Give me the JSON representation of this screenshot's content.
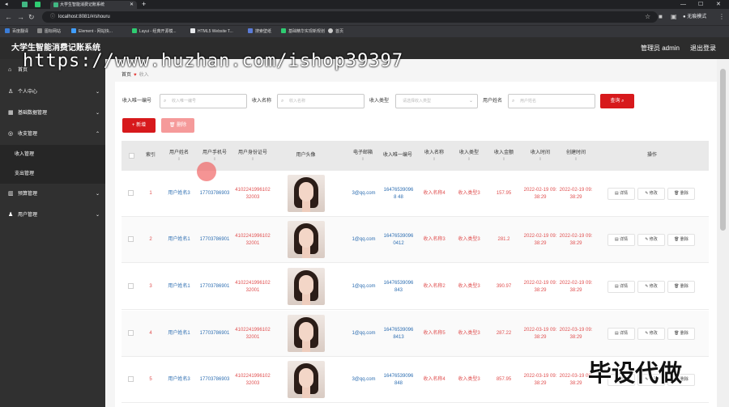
{
  "browser": {
    "tab_title": "大学生智能消费记账系统",
    "url": "localhost:8081/#/shouru",
    "profile_label": "无痕模式",
    "bookmarks": [
      "百度翻译",
      "图标网站",
      "Element - 网站快...",
      "Layui - 经典开源模...",
      "HTML5 Website T...",
      "搜索壁纸",
      "基础精华实现新规划",
      "首页"
    ]
  },
  "header": {
    "title": "大学生智能消费记账系统",
    "admin_label": "管理员 admin",
    "logout_label": "退出登录"
  },
  "sidebar": {
    "items": [
      {
        "label": "首页",
        "icon": "home-icon"
      },
      {
        "label": "个人中心",
        "icon": "user-icon"
      },
      {
        "label": "基础数据管理",
        "icon": "grid-icon"
      },
      {
        "label": "收支管理",
        "icon": "money-icon"
      },
      {
        "label": "收入管理",
        "sub": true
      },
      {
        "label": "支出管理",
        "sub": true
      },
      {
        "label": "预算管理",
        "icon": "chart-icon"
      },
      {
        "label": "用户管理",
        "icon": "users-icon"
      }
    ]
  },
  "breadcrumb": {
    "home": "首页",
    "current": "收入"
  },
  "filters": {
    "code_label": "收入唯一编号",
    "code_placeholder": "收入唯一编号",
    "name_label": "收入名称",
    "name_placeholder": "收入名称",
    "type_label": "收入类型",
    "type_placeholder": "请选择收入类型",
    "user_label": "用户姓名",
    "user_placeholder": "用户姓名",
    "search_button": "查询"
  },
  "actions": {
    "add_button": "+ 新增",
    "delete_button": "删除"
  },
  "table": {
    "headers": [
      "索引",
      "用户姓名",
      "用户手机号",
      "用户身份证号",
      "用户头像",
      "电子邮箱",
      "收入唯一编号",
      "收入名称",
      "收入类型",
      "收入金额",
      "收入时间",
      "创建时间",
      "操作"
    ],
    "op_labels": [
      "详情",
      "修改",
      "删除"
    ],
    "rows": [
      {
        "index": "1",
        "name": "用户姓名3",
        "phone": "17703786903",
        "idcard": "410224199610232003",
        "email": "3@qq.com",
        "code": "164765390968 48",
        "income_name": "收入名称4",
        "income_type": "收入类型3",
        "amount": "157.95",
        "income_time": "2022-02-19 09:38:29",
        "created": "2022-02-19 09:38:29"
      },
      {
        "index": "2",
        "name": "用户姓名1",
        "phone": "17703786901",
        "idcard": "410224199610232001",
        "email": "1@qq.com",
        "code": "164765390960412",
        "income_name": "收入名称3",
        "income_type": "收入类型3",
        "amount": "281.2",
        "income_time": "2022-02-19 09:38:29",
        "created": "2022-02-19 09:38:29"
      },
      {
        "index": "3",
        "name": "用户姓名1",
        "phone": "17703786901",
        "idcard": "410224199610232001",
        "email": "1@qq.com",
        "code": "16476539096843",
        "income_name": "收入名称2",
        "income_type": "收入类型3",
        "amount": "390.97",
        "income_time": "2022-02-19 09:38:29",
        "created": "2022-02-19 09:38:29"
      },
      {
        "index": "4",
        "name": "用户姓名1",
        "phone": "17703786901",
        "idcard": "410224199610232001",
        "email": "1@qq.com",
        "code": "164765390968413",
        "income_name": "收入名称5",
        "income_type": "收入类型3",
        "amount": "287.22",
        "income_time": "2022-03-19 09:38:29",
        "created": "2022-03-19 09:38:29"
      },
      {
        "index": "5",
        "name": "用户姓名3",
        "phone": "17703786903",
        "idcard": "410224199610232003",
        "email": "3@qq.com",
        "code": "16476539096848",
        "income_name": "收入名称4",
        "income_type": "收入类型3",
        "amount": "857.95",
        "income_time": "2022-03-19 09:38:29",
        "created": "2022-03-19 09:38:29"
      }
    ]
  },
  "overlay": {
    "watermark_url": "https://www.huzhan.com/ishop39397",
    "watermark_tag": "毕设代做"
  },
  "colors": {
    "accent": "#d7191c",
    "sidebar": "#303030",
    "link_blue": "#2f6fb2",
    "text_red": "#e05050"
  }
}
